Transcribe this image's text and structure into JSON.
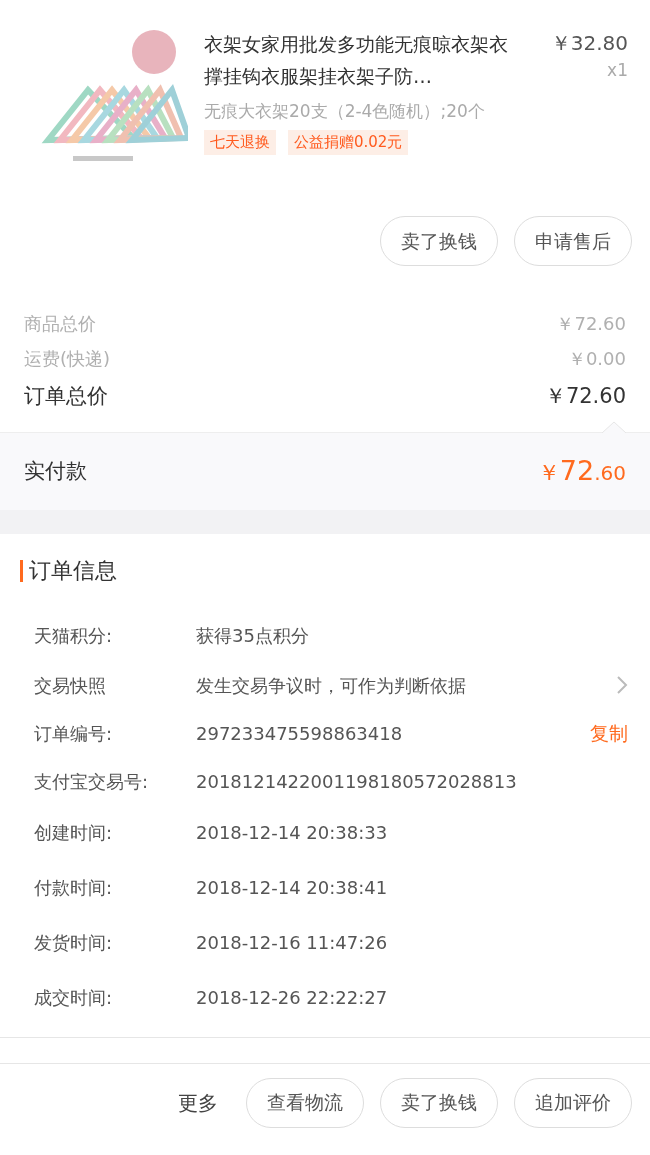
{
  "product": {
    "kind": "picture",
    "title": "衣架女家用批发多功能无痕晾衣架衣撑挂钩衣服架挂衣架子防…",
    "price": "￥32.80",
    "quantity": "x1",
    "spec": "无痕大衣架20支（2-4色随机）;20个",
    "tags": [
      "七天退换",
      "公益捐赠0.02元"
    ],
    "buttons": [
      "卖了换钱",
      "申请售后"
    ]
  },
  "summary": [
    {
      "label": "商品总价",
      "value": "￥72.60",
      "kind": "minor"
    },
    {
      "label": "运费(快递)",
      "value": "￥0.00",
      "kind": "minor"
    },
    {
      "label": "订单总价",
      "value": "￥72.60",
      "kind": "major"
    }
  ],
  "paid": {
    "label": "实付款",
    "currency": "￥",
    "integer": "72",
    "decimal": ".60"
  },
  "order_info": {
    "title": "订单信息",
    "rows": [
      {
        "label": "天猫积分:",
        "value": "获得35点积分",
        "kind": "plain"
      },
      {
        "label": "交易快照",
        "value": "发生交易争议时，可作为判断依据",
        "kind": "link"
      },
      {
        "label": "订单编号:",
        "value": "297233475598863418",
        "kind": "copy",
        "action": "复制"
      },
      {
        "label": "支付宝交易号:",
        "value": "2018121422001198180572028813",
        "kind": "plain"
      },
      {
        "label": "创建时间:",
        "value": "2018-12-14 20:38:33",
        "kind": "plain"
      },
      {
        "label": "付款时间:",
        "value": "2018-12-14 20:38:41",
        "kind": "plain"
      },
      {
        "label": "发货时间:",
        "value": "2018-12-16 11:47:26",
        "kind": "plain"
      },
      {
        "label": "成交时间:",
        "value": "2018-12-26 22:22:27",
        "kind": "plain"
      }
    ]
  },
  "bottom_bar": {
    "more": "更多",
    "buttons": [
      "查看物流",
      "卖了换钱",
      "追加评价"
    ]
  }
}
